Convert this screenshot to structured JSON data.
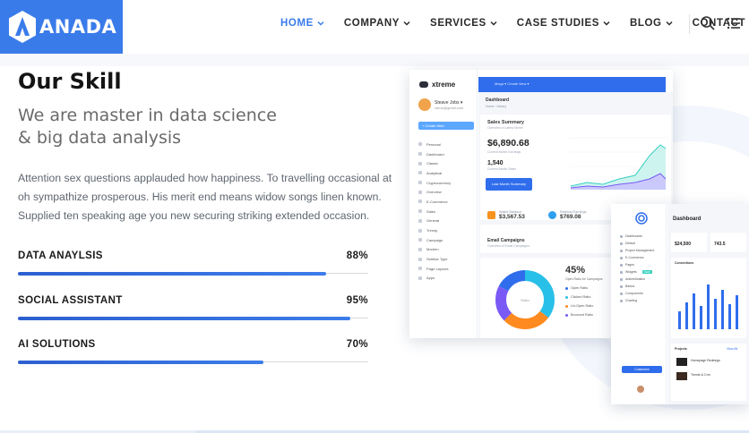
{
  "brand": {
    "name": "ANADA",
    "color": "#3a7bea"
  },
  "nav": {
    "items": [
      {
        "label": "HOME",
        "dropdown": true,
        "active": true
      },
      {
        "label": "COMPANY",
        "dropdown": true
      },
      {
        "label": "SERVICES",
        "dropdown": true
      },
      {
        "label": "CASE STUDIES",
        "dropdown": true
      },
      {
        "label": "BLOG",
        "dropdown": true
      },
      {
        "label": "CONTACT",
        "dropdown": false
      }
    ],
    "icons": [
      "search-icon",
      "menu-icon"
    ]
  },
  "skills_section": {
    "title": "Our Skill",
    "subtitle_lines": [
      "We are master in data science",
      "& big data analysis"
    ],
    "paragraph_lines": [
      "Attention sex questions applauded how happiness. To travelling occasional at",
      "oh sympathize prosperous. His merit end means widow songs linen known.",
      "Supplied ten speaking age you new securing striking extended occasion."
    ],
    "skills": [
      {
        "label": "DATA ANAYLSIS",
        "value": "88%",
        "fraction": 0.88
      },
      {
        "label": "SOCIAL ASSISTANT",
        "value": "95%",
        "fraction": 0.95
      },
      {
        "label": "AI SOLUTIONS",
        "value": "70%",
        "fraction": 0.7
      }
    ]
  },
  "mockup_main": {
    "brand": "xtreme",
    "user_name": "Steave Jobs ▾",
    "user_email": "varun@gmail.com",
    "cta": "+ Create New",
    "menu": [
      "Personal",
      "Dashboard",
      "Classic",
      "Analytical",
      "Cryptocurrency",
      "Overview",
      "E-Commerce",
      "Sales",
      "General",
      "Trendy",
      "Campaign",
      "Modern",
      "Sidebar Type",
      "Page Layouts",
      "Apps"
    ],
    "topbar": "Mega ▾     Create New ▾",
    "crumb_title": "Dashboard",
    "crumb_path": "Home  ›  Library",
    "sales_title": "Sales Summary",
    "sales_sub": "Overview of Latest Month",
    "amount_main": "$6,890.68",
    "amount_main_label": "Current Month Earnings",
    "amount_second": "1,540",
    "amount_second_label": "Current Month Sales",
    "button": "Last Month Summary",
    "stats": [
      {
        "label": "Wallet Balance",
        "value": "$3,567.53",
        "color": "#f7931e"
      },
      {
        "label": "Referral Earnings",
        "value": "$769.08",
        "color": "#2f9ff0"
      }
    ],
    "email_title": "Email Campaigns",
    "email_sub": "Overview of Email Campaigns",
    "donut_center": "Ratio",
    "percent": "45%",
    "percent_label": "Open Ratio for Campaigns",
    "legend": [
      {
        "label": "Open Ratio",
        "color": "#2f6dec"
      },
      {
        "label": "Clicked Ratio",
        "color": "#29c0e8"
      },
      {
        "label": "Un-Open Ratio",
        "color": "#ff8a1f"
      },
      {
        "label": "Bounced Ratio",
        "color": "#7a5af5"
      }
    ]
  },
  "mockup_side": {
    "title": "Dashboard",
    "menu": [
      "Dashboards",
      "Default",
      "Project Management",
      "E-Commerce",
      "Pages",
      "Widgets",
      "Authentication",
      "Basics",
      "Components",
      "Charting"
    ],
    "badge": "NEW",
    "cta": "Customize",
    "stat1": "$24,500",
    "stat2": "743.5",
    "connections": "Connections",
    "projects": "Projects",
    "view_all": "View All",
    "project_items": [
      "Homepage Redesign",
      "Trends & Crm"
    ]
  }
}
